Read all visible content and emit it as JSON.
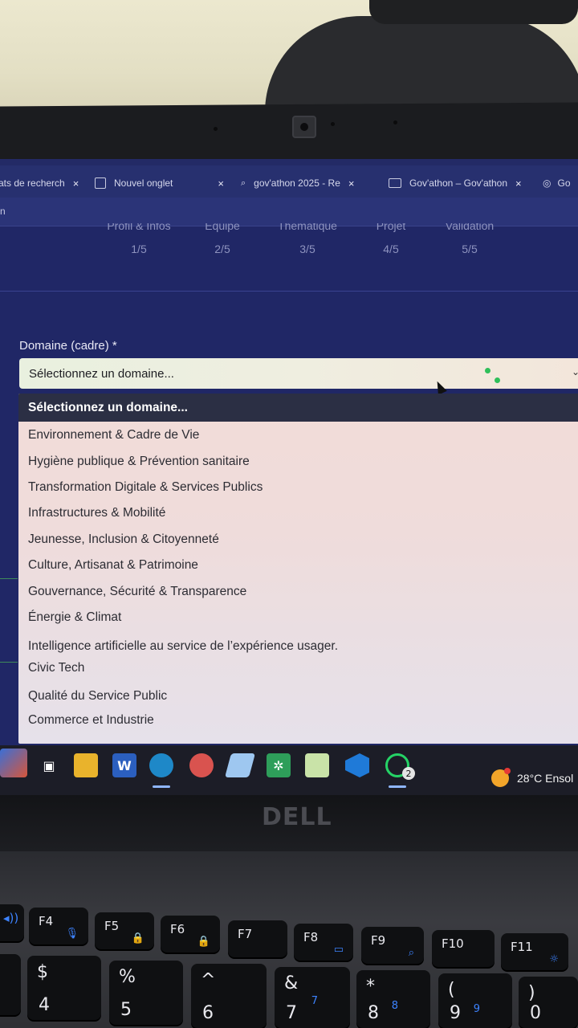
{
  "browser": {
    "tabs": [
      {
        "label": "ats de recherch",
        "close": "×"
      },
      {
        "label": "Nouvel onglet",
        "close": "×"
      },
      {
        "label": "gov'athon 2025 - Re",
        "close": "×"
      },
      {
        "label": "Gov'athon – Gov'athon",
        "close": "×"
      },
      {
        "label": "Go",
        "close": ""
      }
    ],
    "address_fragment": "n"
  },
  "stepper": [
    {
      "label": "Profil & Infos",
      "count": "1/5"
    },
    {
      "label": "Équipe",
      "count": "2/5"
    },
    {
      "label": "Thématique",
      "count": "3/5"
    },
    {
      "label": "Projet",
      "count": "4/5"
    },
    {
      "label": "Validation",
      "count": "5/5"
    }
  ],
  "form": {
    "domain_label": "Domaine (cadre) *",
    "domain_select_value": "Sélectionnez un domaine...",
    "chevron": "⌄"
  },
  "dropdown": {
    "selected": "Sélectionnez un domaine...",
    "options": [
      "Environnement & Cadre de Vie",
      "Hygiène publique & Prévention sanitaire",
      "Transformation Digitale & Services Publics",
      "Infrastructures & Mobilité",
      "Jeunesse, Inclusion & Citoyenneté",
      "Culture, Artisanat & Patrimoine",
      "Gouvernance, Sécurité & Transparence",
      "Énergie & Climat",
      "Intelligence artificielle au service de l’expérience usager.",
      "Civic Tech",
      "Qualité du Service Public",
      "Commerce et Industrie"
    ]
  },
  "taskbar": {
    "apps": [
      "widgets",
      "task-view",
      "file-explorer",
      "word",
      "edge",
      "paint",
      "notes",
      "app-green",
      "notepad",
      "vscode",
      "whatsapp"
    ],
    "whatsapp_badge": "2",
    "weather": "28°C Ensol"
  },
  "hardware": {
    "brand": "DELL",
    "keys_top": [
      "F4",
      "F5",
      "F6",
      "F7",
      "F8",
      "F9",
      "F10",
      "F11"
    ],
    "keys_num": [
      {
        "upper": "$",
        "lower": "4"
      },
      {
        "upper": "%",
        "lower": "5"
      },
      {
        "upper": "^",
        "lower": "6"
      },
      {
        "upper": "&",
        "lower": "7",
        "sub": "7"
      },
      {
        "upper": "*",
        "lower": "8",
        "sub": "8"
      },
      {
        "upper": "(",
        "lower": "9",
        "sub": "9"
      },
      {
        "upper": ")",
        "lower": "0"
      }
    ]
  }
}
